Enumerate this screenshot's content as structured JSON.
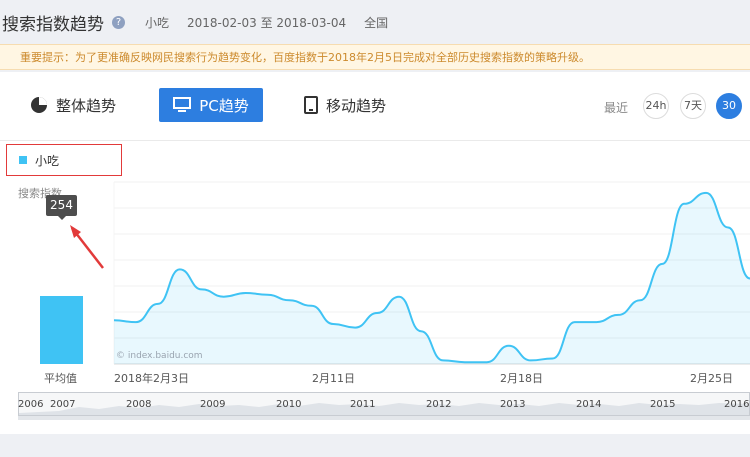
{
  "header": {
    "title": "搜索指数趋势",
    "help": "?",
    "keyword": "小吃",
    "date_range": "2018-02-03 至 2018-03-04",
    "region": "全国"
  },
  "notice": "重要提示：为了更准确反映网民搜索行为趋势变化，百度指数于2018年2月5日完成对全部历史搜索指数的策略升级。",
  "tabs": {
    "whole": "整体趋势",
    "pc": "PC趋势",
    "mobile": "移动趋势"
  },
  "range": {
    "label": "最近",
    "h24": "24h",
    "d7": "7天",
    "d30": "30天"
  },
  "legend": {
    "series_name": "小吃"
  },
  "ylabel": "搜索指数",
  "tooltip": "254",
  "avg_label": "平均值",
  "watermark": "© index.baidu.com",
  "xticks": [
    "2018年2月3日",
    "2月11日",
    "2月18日",
    "2月25日"
  ],
  "years": [
    "2006",
    "2007",
    "2008",
    "2009",
    "2010",
    "2011",
    "2012",
    "2013",
    "2014",
    "2015",
    "2016"
  ],
  "colors": {
    "accent": "#2d7ee0",
    "series": "#3fc3f4",
    "notice": "#cc8a2d",
    "highlight": "#e23a3a"
  },
  "chart_data": {
    "type": "area",
    "series": [
      {
        "name": "小吃",
        "values": [
          0.24,
          0.23,
          0.33,
          0.52,
          0.41,
          0.37,
          0.39,
          0.38,
          0.35,
          0.32,
          0.22,
          0.2,
          0.28,
          0.37,
          0.18,
          0.02,
          0.01,
          0.01,
          0.1,
          0.02,
          0.03,
          0.23,
          0.23,
          0.27,
          0.35,
          0.55,
          0.88,
          0.94,
          0.75,
          0.47
        ]
      }
    ],
    "average": {
      "label": "平均值",
      "value": 254
    },
    "xticks": [
      "2018年2月3日",
      "2月11日",
      "2月18日",
      "2月25日"
    ]
  }
}
